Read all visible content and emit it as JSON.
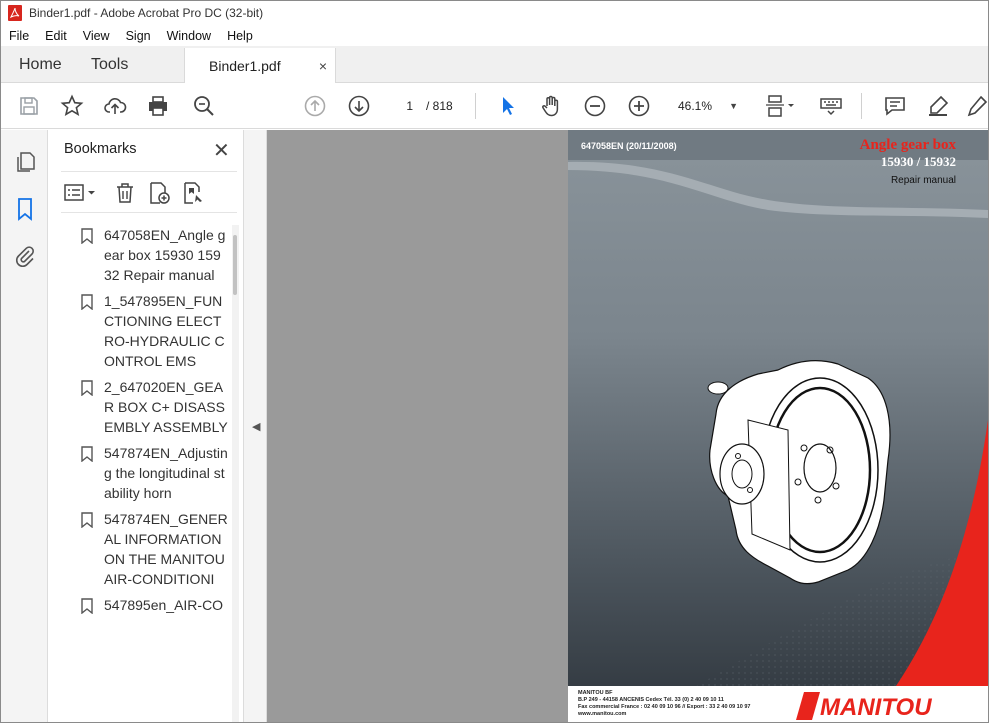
{
  "window": {
    "title": "Binder1.pdf - Adobe Acrobat Pro DC (32-bit)"
  },
  "menu": [
    "File",
    "Edit",
    "View",
    "Sign",
    "Window",
    "Help"
  ],
  "tabs": {
    "home": "Home",
    "tools": "Tools",
    "document": "Binder1.pdf",
    "close": "×"
  },
  "toolbar": {
    "page_current": "1",
    "page_total": "/ 818",
    "zoom": "46.1%",
    "icons": [
      "save-icon",
      "star-icon",
      "upload-icon",
      "print-icon",
      "zoom-search-icon",
      "page-up-icon",
      "page-down-icon",
      "select-arrow-icon",
      "hand-icon",
      "zoom-out-icon",
      "zoom-in-icon",
      "fit-page-icon",
      "keyboard-icon",
      "comment-icon",
      "highlight-icon",
      "draw-icon"
    ]
  },
  "bookmarks": {
    "title": "Bookmarks",
    "close": "✕",
    "items": [
      {
        "label": "647058EN_Angle gear box 15930 15932 Repair manual"
      },
      {
        "label": "1_547895EN_FUNCTIONING ELECTRO-HYDRAULIC CONTROL EMS"
      },
      {
        "label": "2_647020EN_GEAR BOX C+ DISASSEMBLY ASSEMBLY"
      },
      {
        "label": "547874EN_Adjusting the longitudinal stability horn"
      },
      {
        "label": "547874EN_GENERAL INFORMATION ON THE MANITOU AIR-CONDITIONI"
      },
      {
        "label": "547895en_AIR-CO"
      }
    ]
  },
  "page": {
    "doc_ref": "647058EN (20/11/2008)",
    "title": "Angle gear box",
    "models": "15930 / 15932",
    "subtitle": "Repair manual",
    "footer_company": "MANITOU BF",
    "footer_address": "B.P 249 - 44158 ANCENIS Cedex  Tél. 33 (0) 2 40 09 10 11",
    "footer_fax": "Fax commercial France : 02 40 09 10 96 // Export : 33 2 40 09 10 97",
    "footer_web": "www.manitou.com",
    "logo_text": "MANITOU"
  },
  "colors": {
    "acrobat_red": "#d7261e",
    "manitou_red": "#e8241c",
    "page_gray": "#6f7880",
    "select_blue": "#1473e6"
  }
}
